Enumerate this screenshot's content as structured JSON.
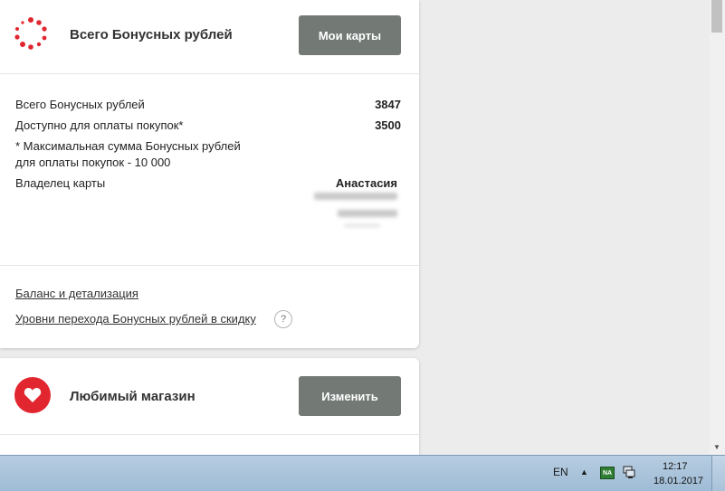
{
  "bonus_card": {
    "title": "Всего Бонусных рублей",
    "button_label": "Мои карты",
    "total_label": "Всего Бонусных рублей",
    "total_value": "3847",
    "available_label": "Доступно для оплаты покупок*",
    "available_value": "3500",
    "note_line1": "* Максимальная сумма Бонусных рублей",
    "note_line2": "для оплаты покупок - 10 000",
    "owner_label": "Владелец карты",
    "owner_name": "Анастасия",
    "links": {
      "balance": "Баланс и детализация",
      "levels": "Уровни перехода Бонусных рублей в скидку"
    },
    "help_glyph": "?"
  },
  "store_card": {
    "title": "Любимый магазин",
    "button_label": "Изменить"
  },
  "colors": {
    "accent_red": "#e1262f",
    "button_gray": "#737a76"
  },
  "icons": {
    "bonus": "dotted-ring-icon",
    "store": "heart-icon",
    "help": "question-icon"
  },
  "taskbar": {
    "language": "EN",
    "tray_badge": "NA",
    "time": "12:17",
    "date": "18.01.2017"
  }
}
